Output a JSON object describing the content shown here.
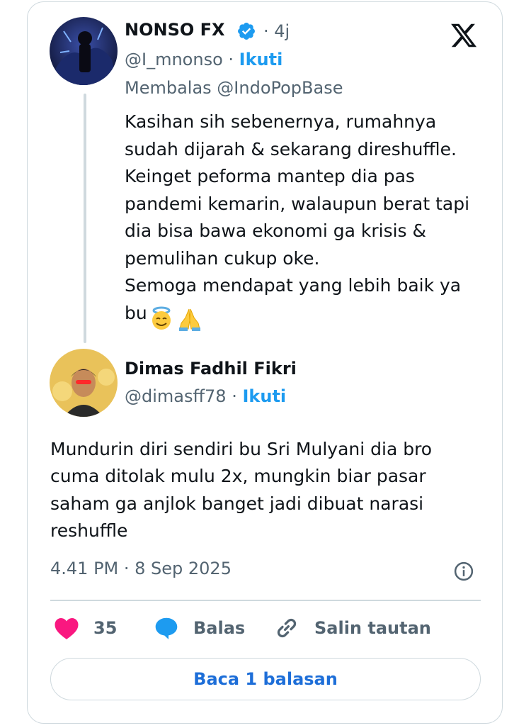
{
  "reply_tweet": {
    "author_name": "NONSO FX",
    "time_ago": "4j",
    "handle": "@I_mnonso",
    "follow_label": "Ikuti",
    "replying_to": "Membalas @IndoPopBase",
    "lines": [
      "Kasihan sih sebenernya, rumahnya",
      "sudah dijarah & sekarang direshuffle.",
      "Keinget peforma mantep dia pas",
      "pandemi kemarin, walaupun berat tapi",
      "dia bisa bawa ekonomi ga krisis &",
      "pemulihan cukup oke.",
      "Semoga mendapat yang lebih baik ya",
      "bu"
    ],
    "emojis": [
      "smiling-face-with-halo",
      "folded-hands"
    ]
  },
  "main_tweet": {
    "author_name": "Dimas Fadhil Fikri",
    "handle": "@dimasff78",
    "follow_label": "Ikuti",
    "lines": [
      "Mundurin diri sendiri bu Sri Mulyani dia bro",
      "cuma ditolak mulu 2x, mungkin biar pasar",
      "saham ga anjlok banget jadi dibuat narasi",
      "reshuffle"
    ],
    "timestamp": "4.41 PM · 8 Sep 2025"
  },
  "actions": {
    "like_count": "35",
    "reply_label": "Balas",
    "copy_link_label": "Salin tautan"
  },
  "read_replies_label": "Baca 1 balasan",
  "colors": {
    "accent": "#1d9bf0",
    "like": "#f91880",
    "text": "#0f1419",
    "muted": "#536471",
    "border": "#cfd9de"
  },
  "icons": [
    "x-logo-icon",
    "verified-badge-icon",
    "info-icon",
    "heart-icon",
    "reply-bubble-icon",
    "link-icon"
  ]
}
